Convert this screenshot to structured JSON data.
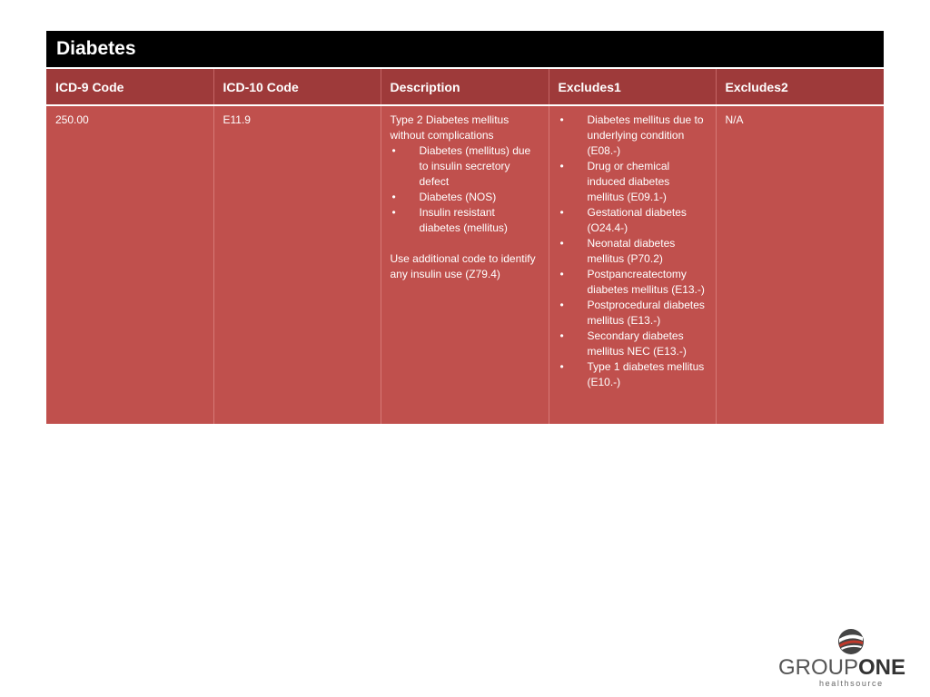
{
  "title": "Diabetes",
  "table": {
    "headers": [
      "ICD-9 Code",
      "ICD-10 Code",
      "Description",
      "Excludes1",
      "Excludes2"
    ],
    "row": {
      "icd9": "250.00",
      "icd10": "E11.9",
      "description": {
        "intro": "Type 2 Diabetes mellitus without complications",
        "bullets": [
          "Diabetes (mellitus) due to insulin secretory defect",
          "Diabetes (NOS)",
          "Insulin resistant diabetes (mellitus)"
        ],
        "note": "Use additional code to identify any insulin use (Z79.4)"
      },
      "excludes1": [
        "Diabetes mellitus due to underlying condition (E08.-)",
        "Drug or chemical induced diabetes mellitus (E09.1-)",
        "Gestational diabetes (O24.4-)",
        "Neonatal diabetes mellitus (P70.2)",
        "Postpancreatectomy diabetes mellitus (E13.-)",
        "Postprocedural diabetes mellitus (E13.-)",
        "Secondary diabetes mellitus NEC (E13.-)",
        "Type 1 diabetes mellitus (E10.-)"
      ],
      "excludes2": "N/A"
    }
  },
  "bullet_glyph": "•",
  "logo": {
    "word_part1": "GROUP",
    "word_part2": "ONE",
    "tagline": "healthsource",
    "colors": {
      "red": "#c0392b",
      "dark": "#333333",
      "gray": "#888888"
    }
  }
}
